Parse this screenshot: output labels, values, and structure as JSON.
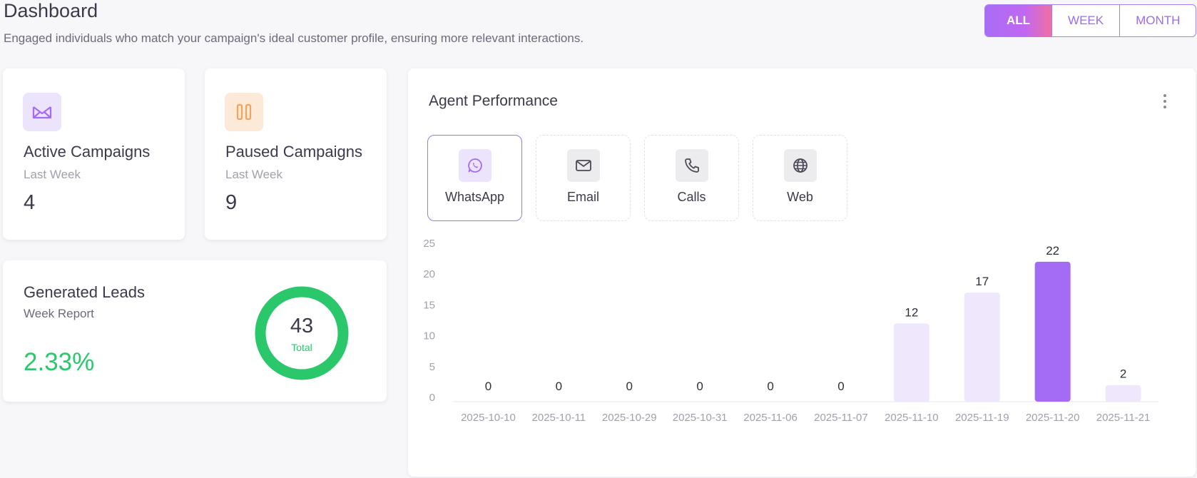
{
  "header": {
    "title": "Dashboard",
    "subtitle": "Engaged individuals who match your campaign's ideal customer profile, ensuring more relevant interactions."
  },
  "filters": {
    "all": "ALL",
    "week": "WEEK",
    "month": "MONTH",
    "active": "all"
  },
  "colors": {
    "accent": "#a46cf5",
    "green": "#2ac76b",
    "orange": "#f2a45c",
    "bar_light": "#efe8fd",
    "bar_highlight": "#a46cf5"
  },
  "active_campaigns": {
    "title": "Active Campaigns",
    "period": "Last Week",
    "value": "4",
    "icon": "envelope-open-icon"
  },
  "paused_campaigns": {
    "title": "Paused Campaigns",
    "period": "Last Week",
    "value": "9",
    "icon": "pause-icon"
  },
  "leads": {
    "title": "Generated Leads",
    "subtitle": "Week Report",
    "percent": "2.33%",
    "total_value": "43",
    "total_label": "Total"
  },
  "performance": {
    "title": "Agent Performance",
    "channels": [
      {
        "label": "WhatsApp",
        "icon": "whatsapp-icon",
        "active": true
      },
      {
        "label": "Email",
        "icon": "email-icon",
        "active": false
      },
      {
        "label": "Calls",
        "icon": "phone-icon",
        "active": false
      },
      {
        "label": "Web",
        "icon": "globe-icon",
        "active": false
      }
    ]
  },
  "chart_data": {
    "type": "bar",
    "categories": [
      "2025-10-10",
      "2025-10-11",
      "2025-10-29",
      "2025-10-31",
      "2025-11-06",
      "2025-11-07",
      "2025-11-10",
      "2025-11-19",
      "2025-11-20",
      "2025-11-21"
    ],
    "values": [
      0,
      0,
      0,
      0,
      0,
      0,
      12,
      17,
      22,
      2
    ],
    "highlighted_category": "2025-11-20",
    "y_ticks": [
      0,
      5,
      10,
      15,
      20,
      25
    ],
    "ylim": [
      0,
      25
    ],
    "grid": false
  }
}
